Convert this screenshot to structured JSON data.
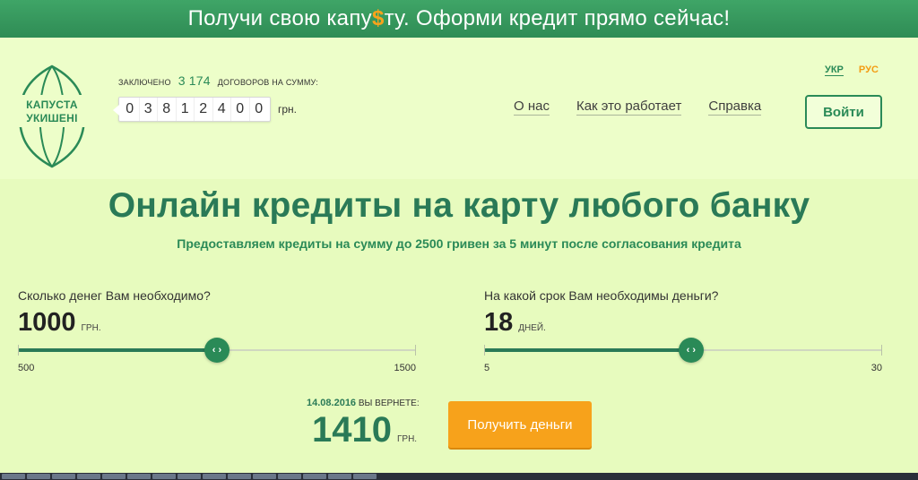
{
  "banner": {
    "before": "Получи свою капу",
    "dollar": "$",
    "after": "ту. Оформи кредит прямо сейчас!"
  },
  "logo": {
    "line1": "КАПУСТА",
    "line2": "УКИШЕНІ"
  },
  "counter": {
    "label_before": "ЗАКЛЮЧЕНО",
    "contracts": "3 174",
    "label_after": "ДОГОВОРОВ НА СУММУ:",
    "digits": [
      "0",
      "3",
      "8",
      "1",
      "2",
      "4",
      "0",
      "0"
    ],
    "unit": "грн."
  },
  "lang": {
    "ukr": "УКР",
    "rus": "РУС"
  },
  "nav": {
    "about": "О нас",
    "how": "Как это работает",
    "help": "Справка"
  },
  "login": "Войти",
  "headline": "Онлайн кредиты на карту любого банку",
  "subline": "Предоставляем кредиты на сумму до 2500 гривен за 5 минут после согласования кредита",
  "amount_slider": {
    "question": "Сколько денег Вам необходимо?",
    "value": "1000",
    "unit": "грн.",
    "min": "500",
    "max": "1500",
    "fraction": 0.5
  },
  "term_slider": {
    "question": "На какой срок Вам необходимы деньги?",
    "value": "18",
    "unit": "дней.",
    "min": "5",
    "max": "30",
    "fraction": 0.52
  },
  "thumb_glyph": "‹ ›",
  "return": {
    "date": "14.08.2016",
    "label": "вы вернете:",
    "value": "1410",
    "unit": "грн."
  },
  "cta": "Получить деньги",
  "colors": {
    "accent": "#2a8a57",
    "orange": "#f7a21b",
    "background": "#eafdc3"
  }
}
